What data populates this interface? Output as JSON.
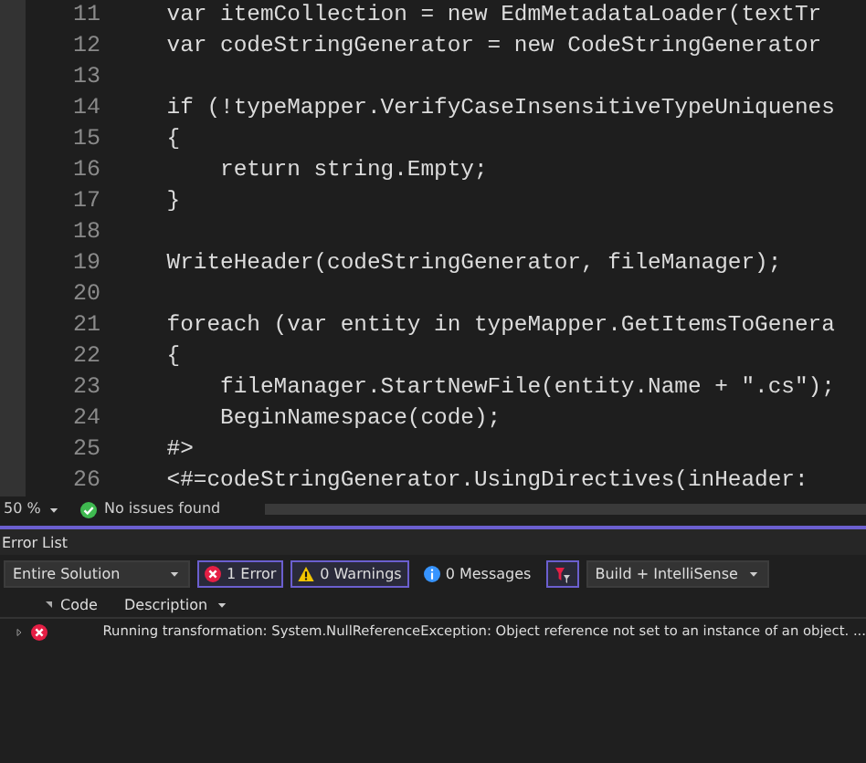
{
  "editor": {
    "lines": [
      {
        "number": "11",
        "code": "    var itemCollection = new EdmMetadataLoader(textTr"
      },
      {
        "number": "12",
        "code": "    var codeStringGenerator = new CodeStringGenerator"
      },
      {
        "number": "13"
      },
      {
        "number": "14",
        "code": "    if (!typeMapper.VerifyCaseInsensitiveTypeUniquenes"
      },
      {
        "number": "15",
        "code": "    {"
      },
      {
        "number": "16",
        "code": "        return string.Empty;"
      },
      {
        "number": "17",
        "code": "    }"
      },
      {
        "number": "18"
      },
      {
        "number": "19",
        "code": "    WriteHeader(codeStringGenerator, fileManager);"
      },
      {
        "number": "20"
      },
      {
        "number": "21",
        "code": "    foreach (var entity in typeMapper.GetItemsToGenera"
      },
      {
        "number": "22",
        "code": "    {"
      },
      {
        "number": "23",
        "code": "        fileManager.StartNewFile(entity.Name + \".cs\");"
      },
      {
        "number": "24",
        "code": "        BeginNamespace(code);"
      },
      {
        "number": "25",
        "code": "    #>"
      },
      {
        "number": "26",
        "code": "    <#=codeStringGenerator.UsingDirectives(inHeader:"
      }
    ]
  },
  "status_bar": {
    "zoom": "50 %",
    "issues": "No issues found"
  },
  "error_list": {
    "title": "Error List",
    "scope": "Entire Solution",
    "filters": [
      {
        "kind": "error",
        "label": "1 Error",
        "selected": true
      },
      {
        "kind": "warning",
        "label": "0 Warnings",
        "selected": true
      },
      {
        "kind": "message",
        "label": "0 Messages",
        "selected": false
      }
    ],
    "source": "Build + IntelliSense",
    "columns": [
      "Code",
      "Description"
    ],
    "rows": [
      {
        "kind": "error",
        "description": "Running transformation: System.NullReferenceException: Object reference not set to an instance of an object. ..."
      }
    ]
  }
}
